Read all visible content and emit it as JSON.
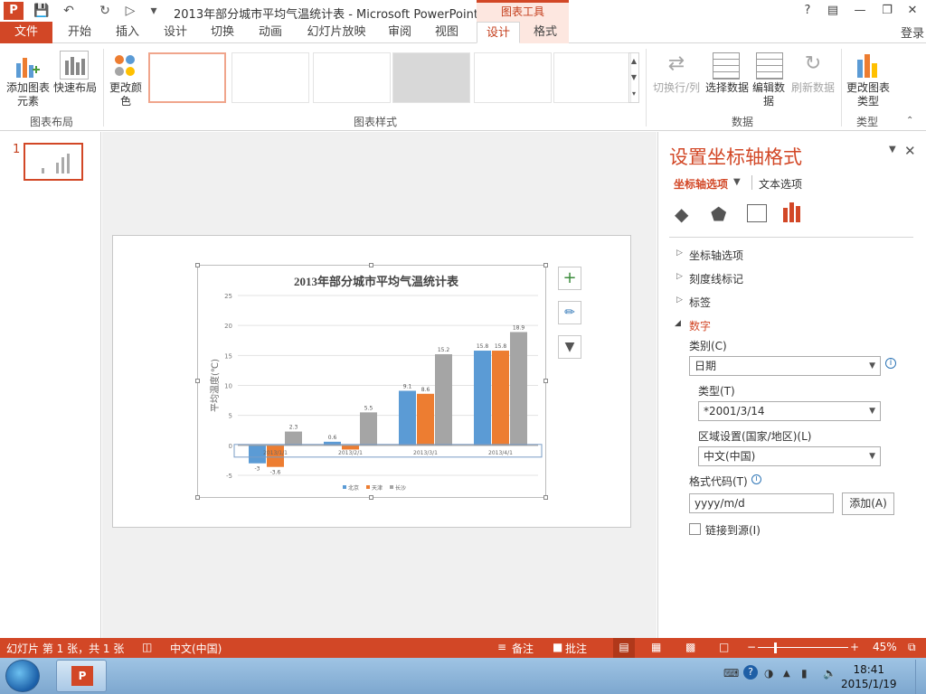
{
  "window": {
    "title": "2013年部分城市平均气温统计表 - Microsoft PowerPoint",
    "logo_text": "P",
    "contextual_tab": "图表工具",
    "help": "?",
    "login": "登录"
  },
  "tabs": {
    "file": "文件",
    "items": [
      "开始",
      "插入",
      "设计",
      "切换",
      "动画",
      "幻灯片放映",
      "审阅",
      "视图",
      "设计",
      "格式"
    ]
  },
  "ribbon": {
    "add_element": "添加图表元素",
    "quick_layout": "快速布局",
    "group_layout": "图表布局",
    "change_color": "更改颜色",
    "group_styles": "图表样式",
    "switch_rowcol": "切换行/列",
    "select_data": "选择数据",
    "edit_data": "编辑数据",
    "refresh_data": "刷新数据",
    "group_data": "数据",
    "change_type": "更改图表类型",
    "group_type": "类型"
  },
  "thumbnails": {
    "slide_number": "1"
  },
  "chart_data": {
    "type": "bar",
    "title": "2013年部分城市平均气温统计表",
    "ylabel": "平均温度(℃)",
    "xlabel": "",
    "categories": [
      "2013/1/1",
      "2013/2/1",
      "2013/3/1",
      "2013/4/1"
    ],
    "series": [
      {
        "name": "北京",
        "values": [
          -3,
          0.6,
          9.1,
          15.8
        ],
        "color": "#5b9bd5"
      },
      {
        "name": "天津",
        "values": [
          -3.6,
          -0.7,
          8.6,
          15.8
        ],
        "color": "#ed7d31"
      },
      {
        "name": "长沙",
        "values": [
          2.3,
          5.5,
          15.2,
          18.9
        ],
        "color": "#a5a5a5"
      }
    ],
    "data_labels": [
      [
        "-3",
        "0.6",
        "9.1",
        "15.8"
      ],
      [
        "-3.6",
        "",
        "8.6",
        "15.8"
      ],
      [
        "2.3",
        "5.5",
        "15.2",
        "18.9"
      ]
    ],
    "ylim": [
      -5,
      25
    ],
    "yticks": [
      "25",
      "20",
      "15",
      "10",
      "5",
      "0",
      "-5"
    ],
    "grid": true,
    "legend": "bottom"
  },
  "pane": {
    "title": "设置坐标轴格式",
    "tab_axis": "坐标轴选项",
    "tab_text": "文本选项",
    "sec_axis": "坐标轴选项",
    "sec_ticks": "刻度线标记",
    "sec_labels": "标签",
    "sec_number": "数字",
    "category_label": "类别(C)",
    "category_value": "日期",
    "type_label": "类型(T)",
    "type_value": "*2001/3/14",
    "locale_label": "区域设置(国家/地区)(L)",
    "locale_value": "中文(中国)",
    "format_code_label": "格式代码(T)",
    "format_code_value": "yyyy/m/d",
    "add_button": "添加(A)",
    "link_source": "链接到源(I)"
  },
  "status": {
    "slide_info": "幻灯片 第 1 张，共 1 张",
    "language": "中文(中国)",
    "notes": "备注",
    "comments": "批注",
    "zoom": "45%"
  },
  "taskbar": {
    "time": "18:41",
    "date": "2015/1/19"
  }
}
